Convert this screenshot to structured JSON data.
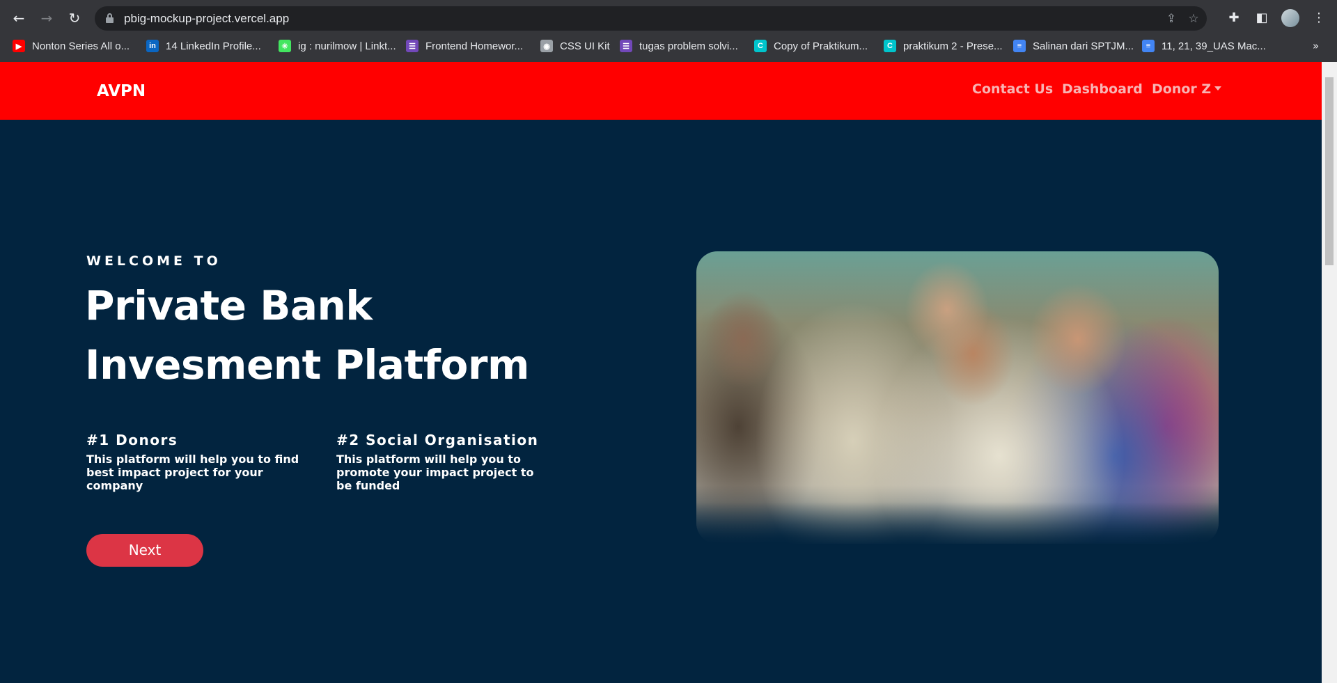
{
  "browser": {
    "url": "pbig-mockup-project.vercel.app",
    "bookmarks": [
      {
        "label": "Nonton Series All o...",
        "icon": "youtube-icon",
        "color": "#ff0000"
      },
      {
        "label": "14 LinkedIn Profile...",
        "icon": "linkedin-icon",
        "color": "#0a66c2"
      },
      {
        "label": "ig : nurilmow | Linkt...",
        "icon": "linktree-icon",
        "color": "#43e660"
      },
      {
        "label": "Frontend Homewor...",
        "icon": "list-icon",
        "color": "#7248b9"
      },
      {
        "label": "CSS UI Kit",
        "icon": "globe-icon",
        "color": "#9aa0a6"
      },
      {
        "label": "tugas problem solvi...",
        "icon": "list-icon",
        "color": "#7248b9"
      },
      {
        "label": "Copy of Praktikum...",
        "icon": "canva-icon",
        "color": "#00c4cc"
      },
      {
        "label": "praktikum 2 - Prese...",
        "icon": "canva-icon",
        "color": "#00c4cc"
      },
      {
        "label": "Salinan dari SPTJM...",
        "icon": "docs-icon",
        "color": "#4285f4"
      },
      {
        "label": "11, 21, 39_UAS Mac...",
        "icon": "docs-icon",
        "color": "#4285f4"
      }
    ],
    "more": "»"
  },
  "navbar": {
    "brand": "AVPN",
    "links": [
      "Contact Us",
      "Dashboard"
    ],
    "user_menu": "Donor Z",
    "bg_color": "#ff0000"
  },
  "hero": {
    "eyebrow": "WELCOME TO",
    "title_line1": "Private Bank",
    "title_line2": "Invesment Platform",
    "features": [
      {
        "title": "#1 Donors",
        "text": "This platform will help you to find best impact project for your company"
      },
      {
        "title": "#2 Social Organisation",
        "text": "This platform will help you to promote your impact project to be funded"
      }
    ],
    "cta": "Next",
    "cta_color": "#dc3545",
    "bg_color": "#02243f"
  }
}
